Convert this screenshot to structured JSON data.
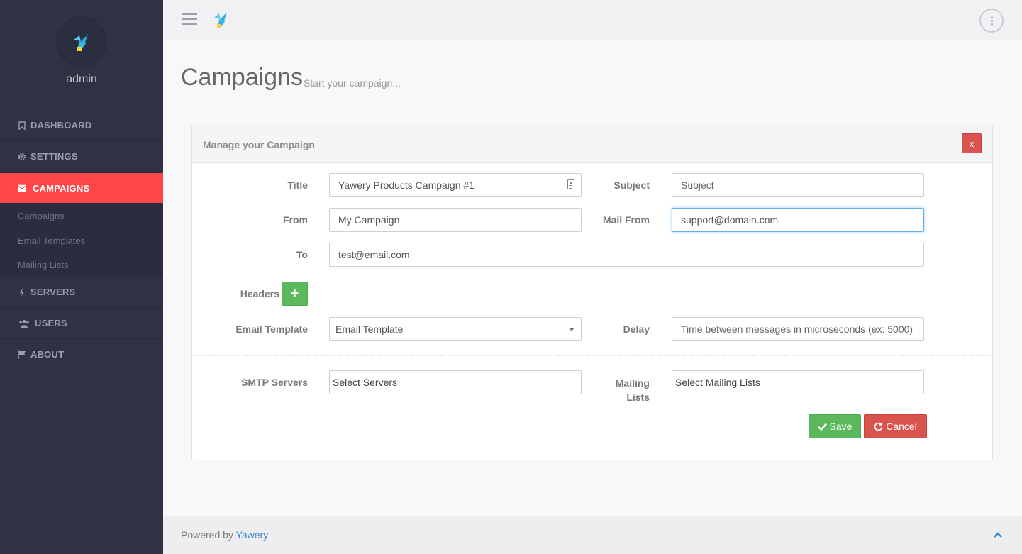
{
  "sidebar": {
    "user": "admin",
    "nav": {
      "dashboard": "DASHBOARD",
      "settings": "SETTINGS",
      "campaigns": "CAMPAIGNS",
      "servers": "SERVERS",
      "users": "USERS",
      "about": "ABOUT"
    },
    "submenu": [
      "Campaigns",
      "Email Templates",
      "Mailing Lists"
    ],
    "accent_color": "#ff4646"
  },
  "page": {
    "title": "Campaigns",
    "subtitle": "Start your campaign..."
  },
  "panel": {
    "title": "Manage your Campaign",
    "close_label": "x",
    "labels": {
      "title": "Title",
      "subject": "Subject",
      "from": "From",
      "mail_from": "Mail From",
      "to": "To",
      "headers": "Headers",
      "email_template": "Email Template",
      "delay": "Delay",
      "smtp_servers": "SMTP Servers",
      "mailing_lists_1": "Mailing",
      "mailing_lists_2": "Lists"
    },
    "values": {
      "title": "Yawery Products Campaign #1",
      "subject_placeholder": "Subject",
      "from": "My Campaign",
      "mail_from": "support@domain.com",
      "to": "test@email.com",
      "email_template": "Email Template",
      "delay_placeholder": "Time between messages in microseconds (ex: 5000)",
      "smtp_servers": "Select Servers",
      "mailing_lists": "Select Mailing Lists"
    },
    "buttons": {
      "add_header": "+",
      "save": "Save",
      "cancel": "Cancel"
    }
  },
  "footer": {
    "prefix": "Powered by ",
    "link": "Yawery"
  }
}
